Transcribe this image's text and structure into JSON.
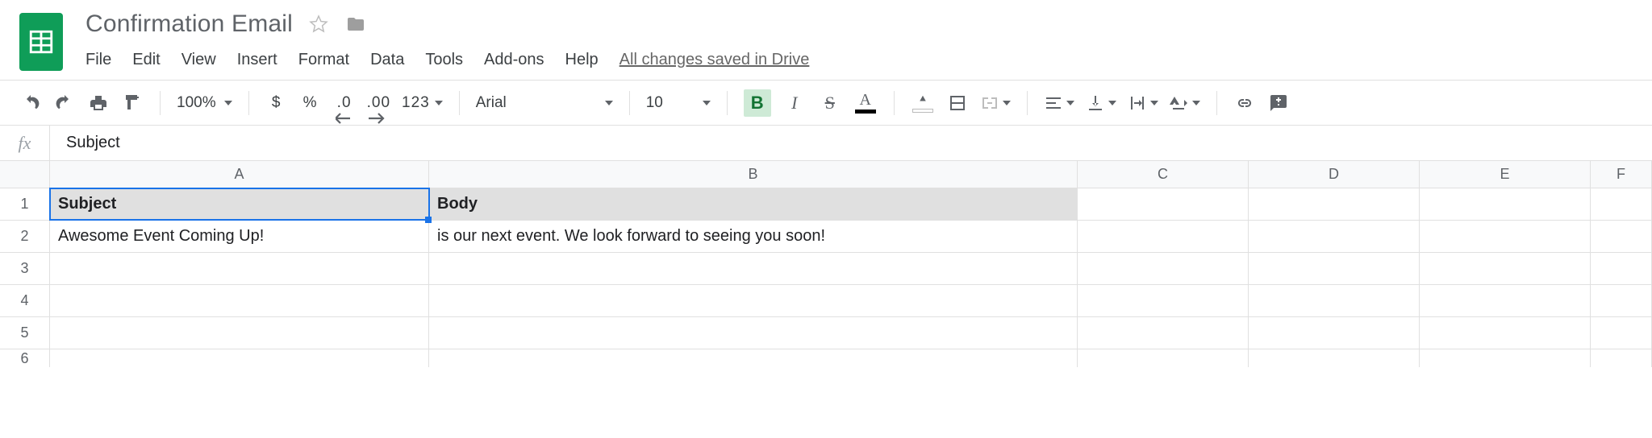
{
  "header": {
    "title": "Confirmation Email",
    "menu": [
      "File",
      "Edit",
      "View",
      "Insert",
      "Format",
      "Data",
      "Tools",
      "Add-ons",
      "Help"
    ],
    "save_status": "All changes saved in Drive"
  },
  "toolbar": {
    "zoom": "100%",
    "currency": "$",
    "percent": "%",
    "dec_less": ".0",
    "dec_more": ".00",
    "num_format": "123",
    "font": "Arial",
    "font_size": "10",
    "bold": "B",
    "italic": "I",
    "strike": "S",
    "text_color_letter": "A"
  },
  "formula_bar": {
    "fx_label": "fx",
    "content": "Subject"
  },
  "columns": [
    "A",
    "B",
    "C",
    "D",
    "E",
    "F"
  ],
  "rows": [
    "1",
    "2",
    "3",
    "4",
    "5",
    "6"
  ],
  "cells": {
    "A1": "Subject",
    "B1": "Body",
    "A2": "Awesome Event Coming Up!",
    "B2": "is our next event. We look forward to seeing you soon!"
  },
  "chart_data": {
    "type": "table",
    "columns": [
      "Subject",
      "Body"
    ],
    "rows": [
      [
        "Awesome Event Coming Up!",
        "is our next event. We look forward to seeing you soon!"
      ]
    ]
  }
}
